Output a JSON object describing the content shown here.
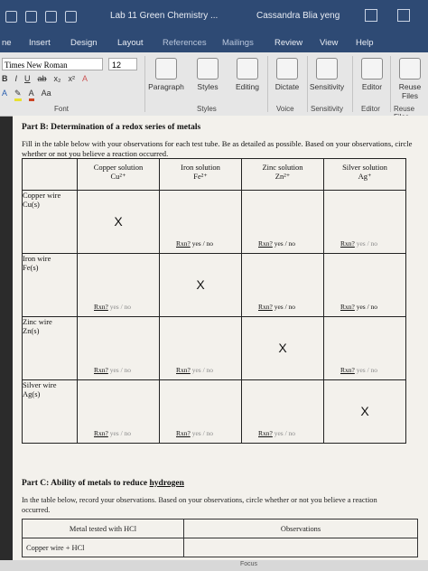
{
  "titlebar": {
    "doc_title": "Lab 11 Green Chemistry ...",
    "user": "Cassandra Blia yeng"
  },
  "tabs": [
    "ne",
    "Insert",
    "Design",
    "Layout",
    "References",
    "Mailings",
    "Review",
    "View",
    "Help"
  ],
  "ribbon": {
    "font_name": "Times New Roman",
    "font_size": "12",
    "format_row1": [
      "B",
      "I",
      "U",
      "ab",
      "x₂",
      "x²",
      "A"
    ],
    "format_row2": [
      "A",
      "A",
      "Aa"
    ],
    "groups": [
      "Paragraph",
      "Styles",
      "Editing",
      "Dictate",
      "Sensitivity",
      "Editor",
      "Reuse Files"
    ],
    "group_labels": [
      "Font",
      "Styles",
      "Voice",
      "Sensitivity",
      "Editor",
      "Reuse Files"
    ]
  },
  "doc": {
    "partB_title": "Part B: Determination of a redox series of metals",
    "partB_instructions": "Fill in the table below with your observations for each test tube. Be as detailed as possible. Based on your observations, circle whether or not you believe a reaction occurred.",
    "columns": [
      {
        "name": "Copper solution",
        "ion": "Cu²⁺"
      },
      {
        "name": "Iron solution",
        "ion": "Fe²⁺"
      },
      {
        "name": "Zinc solution",
        "ion": "Zn²⁺"
      },
      {
        "name": "Silver solution",
        "ion": "Ag⁺"
      }
    ],
    "rows": [
      {
        "name": "Copper wire",
        "formula": "Cu(s)"
      },
      {
        "name": "Iron wire",
        "formula": "Fe(s)"
      },
      {
        "name": "Zinc wire",
        "formula": "Zn(s)"
      },
      {
        "name": "Silver wire",
        "formula": "Ag(s)"
      }
    ],
    "x_mark": "X",
    "rxn_label": "Rxn?",
    "rxn_options": "yes / no",
    "partC_prefix": "Part C: Ability of metals to reduce ",
    "partC_highlight": "hydrogen",
    "partC_instructions": "In the table below, record your observations. Based on your observations, circle whether or not you believe a reaction occurred.",
    "partC_headers": [
      "Metal tested with HCl",
      "Observations"
    ],
    "partC_rows": [
      "Copper wire + HCl"
    ]
  },
  "status": {
    "focus": "Focus"
  }
}
